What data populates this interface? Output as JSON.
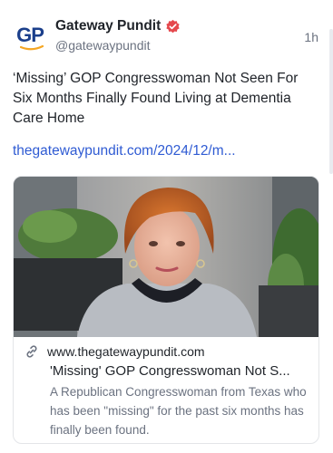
{
  "author": {
    "avatar_initials": "GP",
    "display_name": "Gateway Pundit",
    "handle": "@gatewaypundit",
    "verified": true,
    "timestamp": "1h"
  },
  "post": {
    "text": "‘Missing’ GOP Congresswoman Not Seen For Six Months Finally Found Living at Dementia Care Home",
    "link_text": "thegatewaypundit.com/2024/12/m..."
  },
  "link_card": {
    "image_icon": "woman-portrait-photo",
    "domain": "www.thegatewaypundit.com",
    "title": "'Missing' GOP Congresswoman Not S...",
    "description": "A Republican Congresswoman from Texas who has been \"missing\" for the past six months has finally been found."
  },
  "colors": {
    "brand_blue": "#1b3f8b",
    "brand_orange": "#f5a623",
    "verified_badge": "#e5484d",
    "link_blue": "#2f5bd3",
    "muted_text": "#6b7280"
  }
}
